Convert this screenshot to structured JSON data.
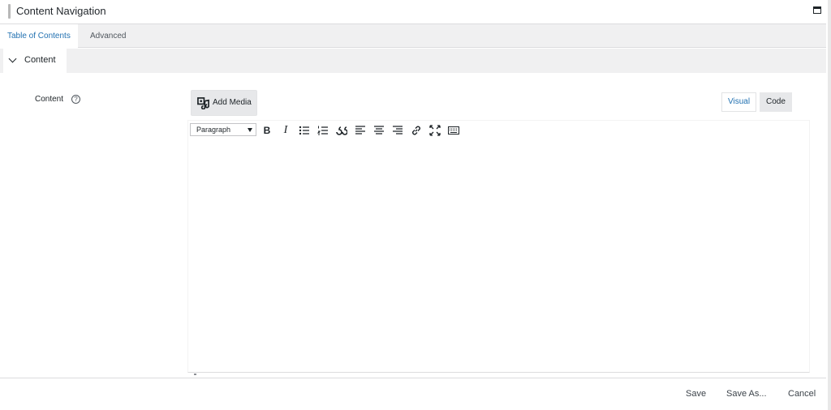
{
  "window": {
    "title": "Content Navigation"
  },
  "tabs": [
    {
      "label": "Table of Contents",
      "active": true
    },
    {
      "label": "Advanced",
      "active": false
    }
  ],
  "section": {
    "label": "Content"
  },
  "field": {
    "label": "Content",
    "help_glyph": "?"
  },
  "media": {
    "add_label": "Add Media"
  },
  "editor_modes": {
    "visual": "Visual",
    "code": "Code"
  },
  "toolbar": {
    "format_select": "Paragraph",
    "bold": "B",
    "italic": "I"
  },
  "footer": {
    "save": "Save",
    "save_as": "Save As...",
    "cancel": "Cancel"
  },
  "colors": {
    "accent": "#2271b1",
    "panel": "#f0f0f1",
    "button": "#e7e8ea"
  }
}
